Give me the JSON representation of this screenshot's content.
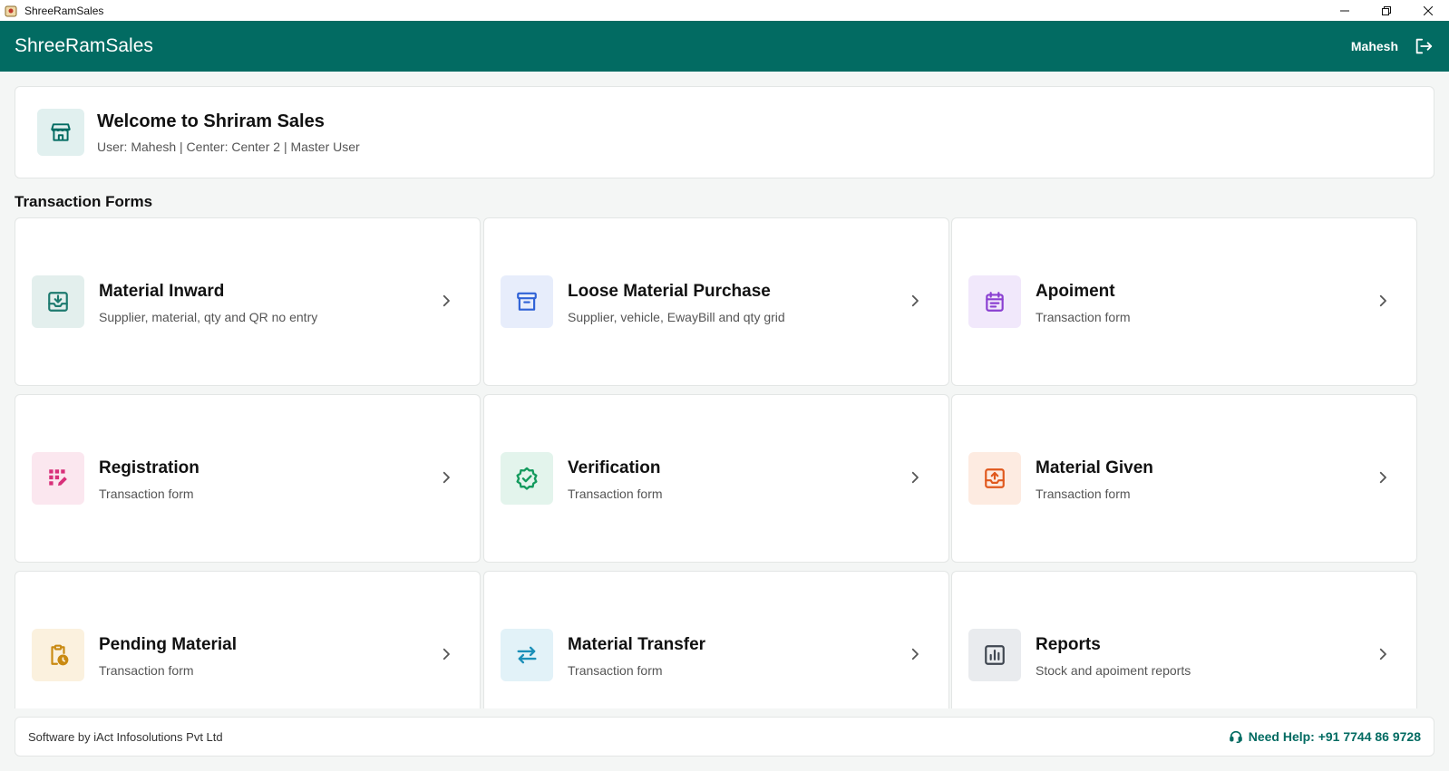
{
  "window": {
    "title": "ShreeRamSales"
  },
  "appbar": {
    "app_name": "ShreeRamSales",
    "user_name": "Mahesh"
  },
  "welcome": {
    "title": "Welcome to Shriram Sales",
    "subtitle": "User: Mahesh | Center: Center 2 | Master User"
  },
  "section": {
    "title": "Transaction Forms"
  },
  "cards": [
    {
      "title": "Material Inward",
      "subtitle": "Supplier, material, qty and QR no entry",
      "icon": "inbox-download-icon",
      "color": "#1d7a6f",
      "bg": "#e3efed"
    },
    {
      "title": "Loose Material Purchase",
      "subtitle": "Supplier, vehicle, EwayBill and qty grid",
      "icon": "archive-box-icon",
      "color": "#2f62d6",
      "bg": "#e7edfb"
    },
    {
      "title": "Apoiment",
      "subtitle": "Transaction form",
      "icon": "calendar-icon",
      "color": "#8a3fd1",
      "bg": "#f1e8fb"
    },
    {
      "title": "Registration",
      "subtitle": "Transaction form",
      "icon": "registration-pen-icon",
      "color": "#d8307a",
      "bg": "#fbe7ef"
    },
    {
      "title": "Verification",
      "subtitle": "Transaction form",
      "icon": "verified-badge-icon",
      "color": "#139a5d",
      "bg": "#e3f4ec"
    },
    {
      "title": "Material Given",
      "subtitle": "Transaction form",
      "icon": "outbox-upload-icon",
      "color": "#e0581d",
      "bg": "#fdebe1"
    },
    {
      "title": "Pending Material",
      "subtitle": "Transaction form",
      "icon": "clipboard-clock-icon",
      "color": "#c98a12",
      "bg": "#fbf1de"
    },
    {
      "title": "Material Transfer",
      "subtitle": "Transaction form",
      "icon": "swap-arrows-icon",
      "color": "#1a8fb8",
      "bg": "#e2f2f8"
    },
    {
      "title": "Reports",
      "subtitle": "Stock and apoiment reports",
      "icon": "bar-chart-icon",
      "color": "#3f4650",
      "bg": "#e9ebee"
    }
  ],
  "footer": {
    "credit": "Software by iAct Infosolutions Pvt Ltd",
    "help": "Need Help: +91 7744 86 9728"
  },
  "colors": {
    "primary": "#026b62",
    "background": "#f4f6f5"
  }
}
